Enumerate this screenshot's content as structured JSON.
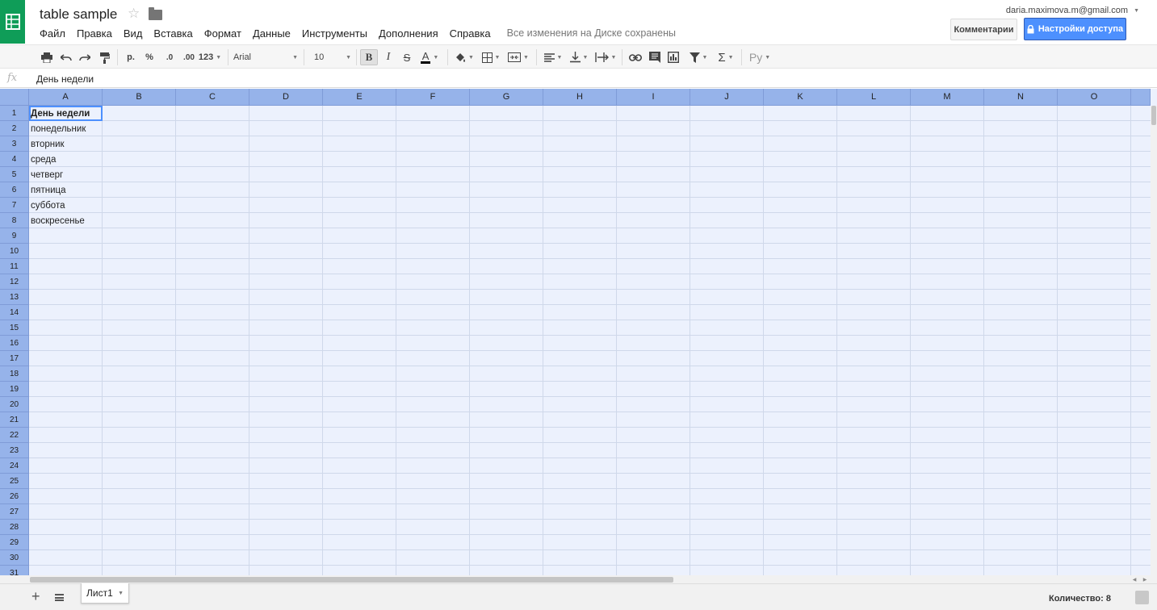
{
  "document": {
    "title": "table sample"
  },
  "menus": [
    "Файл",
    "Правка",
    "Вид",
    "Вставка",
    "Формат",
    "Данные",
    "Инструменты",
    "Дополнения",
    "Справка"
  ],
  "save_status": "Все изменения на Диске сохранены",
  "account": {
    "email": "daria.maximova.m@gmail.com"
  },
  "buttons": {
    "comments": "Комментарии",
    "share": "Настройки доступа"
  },
  "toolbar": {
    "currency": "р.",
    "percent": "%",
    "decrease_decimals": ".0",
    "increase_decimals": ".00",
    "more_formats": "123",
    "font": "Arial",
    "font_size": "10",
    "bold": "B",
    "italic": "I",
    "strike": "S",
    "text_color": "A",
    "sum": "Σ",
    "input_tools": "Ру"
  },
  "formula_bar": {
    "value": "День недели"
  },
  "columns": [
    "A",
    "B",
    "C",
    "D",
    "E",
    "F",
    "G",
    "H",
    "I",
    "J",
    "K",
    "L",
    "M",
    "N",
    "O"
  ],
  "rows": [
    "1",
    "2",
    "3",
    "4",
    "5",
    "6",
    "7",
    "8",
    "9",
    "10",
    "11",
    "12",
    "13",
    "14",
    "15",
    "16",
    "17",
    "18",
    "19",
    "20",
    "21",
    "22",
    "23",
    "24",
    "25",
    "26",
    "27",
    "28",
    "29",
    "30",
    "31"
  ],
  "cells": [
    "День недели",
    "понедельник",
    "вторник",
    "среда",
    "четверг",
    "пятница",
    "суббота",
    "воскресенье"
  ],
  "selected_cell": "A1",
  "sheets": [
    {
      "name": "Лист1",
      "active": true
    }
  ],
  "status": {
    "count": "Количество: 8"
  },
  "colors": {
    "header_bg": "#96b3ea",
    "grid_bg": "#ecf1fd",
    "share_button": "#4d90fe",
    "logo_green": "#0f9d58"
  }
}
